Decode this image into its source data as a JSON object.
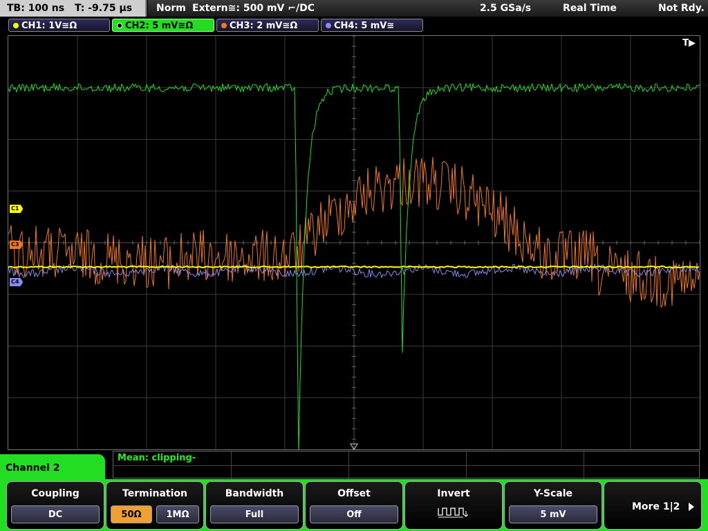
{
  "status": {
    "timebase": "TB: 100 ns",
    "trigger_time": "T: -9.75 µs",
    "mode": "Norm",
    "trigger": "Extern≅: 500 mV ⌐/DC",
    "sample_rate": "2.5 GSa/s",
    "acq_mode": "Real Time",
    "state": "Not Rdy."
  },
  "channels": [
    {
      "label": "CH1: 1V≅Ω",
      "color": "#ffff00"
    },
    {
      "label": "CH2: 5 mV≅Ω",
      "color": "#22dd22"
    },
    {
      "label": "CH3: 2 mV≅Ω",
      "color": "#f07820"
    },
    {
      "label": "CH4: 5 mV≅",
      "color": "#8888ee"
    }
  ],
  "markers": {
    "c1": "C1",
    "c3": "C3",
    "c4": "C4",
    "trigger": "T▶"
  },
  "measurement": {
    "text": "Mean: clipping-"
  },
  "channel_tag": "Channel 2",
  "menu": {
    "coupling": {
      "title": "Coupling",
      "value": "DC"
    },
    "termination": {
      "title": "Termination",
      "opt1": "50Ω",
      "opt2": "1MΩ"
    },
    "bandwidth": {
      "title": "Bandwidth",
      "value": "Full"
    },
    "offset": {
      "title": "Offset",
      "value": "Off"
    },
    "invert": {
      "title": "Invert"
    },
    "yscale": {
      "title": "Y-Scale",
      "value": "5 mV"
    },
    "more": "More 1|2"
  }
}
